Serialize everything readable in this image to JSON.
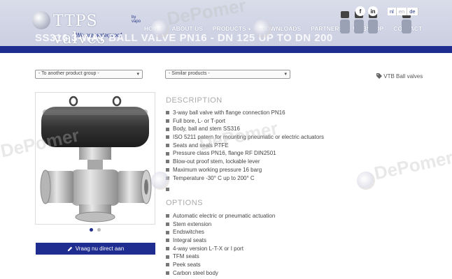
{
  "header": {
    "logo_text": "TTPS valves",
    "logo_byline": "by vapo",
    "logo_tagline": "We are waterproof",
    "nav": [
      {
        "label": "HOME",
        "has_dropdown": false
      },
      {
        "label": "ABOUT US",
        "has_dropdown": false
      },
      {
        "label": "PRODUCTS",
        "has_dropdown": true
      },
      {
        "label": "DOWNLOADS",
        "has_dropdown": false
      },
      {
        "label": "PARTNERS",
        "has_dropdown": false
      },
      {
        "label": "WEBSHOP",
        "has_dropdown": false
      },
      {
        "label": "CONTACT",
        "has_dropdown": false
      }
    ],
    "social": {
      "facebook": "f",
      "linkedin": "in"
    },
    "languages": [
      "nl",
      "en",
      "de"
    ]
  },
  "page_title": "SS316 3-WAY BALL VALVE PN16 - DN 125 UP TO DN 200",
  "selects": {
    "product_group": "- To another product group -",
    "similar_products": "- Similar products -"
  },
  "tag_link": "VTB Ball valves",
  "gallery": {
    "slide_count": 2,
    "active_slide": 1
  },
  "contact_button": "Vraag nu direct aan",
  "description": {
    "title": "DESCRIPTION",
    "items": [
      "3-way ball valve with flange connection PN16",
      "Full bore, L- or T-port",
      "Body, ball and stem SS316",
      "ISO 5211 patern for mounting pneumatic or electric actuators",
      "Seats and seals PTFE",
      "Pressure class PN16, flange RF DIN2501",
      "Blow-out proof stem, lockable lever",
      "Maximum working pressure 16 barg",
      "Temperature -30° C up to 200° C",
      ""
    ]
  },
  "options": {
    "title": "OPTIONS",
    "items": [
      "Automatic electric or pneumatic actuation",
      "Stem extension",
      "Endswitches",
      "Integral seats",
      "4-way version L-T-X or I port",
      "TFM seats",
      "Peek seats",
      "Carbon steel body"
    ]
  },
  "watermark": "DePomer",
  "colors": {
    "brand_blue": "#1e2d8f",
    "header_bg": "#cdd1e3",
    "section_title": "#aaaaaa"
  },
  "icons": {
    "tag": "tag-icon",
    "pencil": "pencil-icon",
    "facebook": "facebook-icon",
    "linkedin": "linkedin-icon"
  }
}
